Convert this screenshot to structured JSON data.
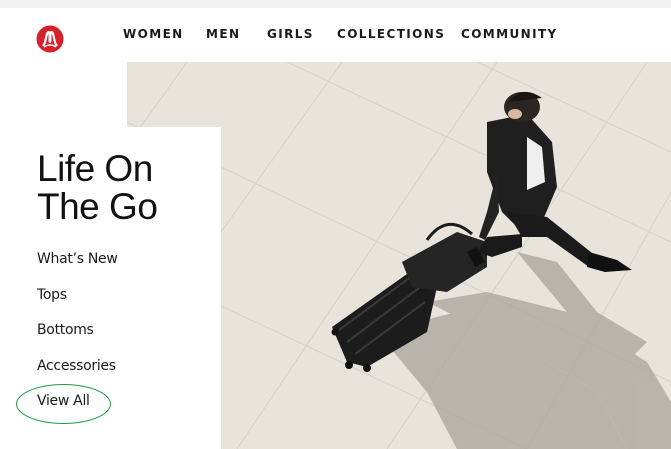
{
  "brand": {
    "logo_icon": "lululemon-logo-icon",
    "color": "#d6202a"
  },
  "nav": {
    "items": [
      "WOMEN",
      "MEN",
      "GIRLS",
      "COLLECTIONS",
      "COMMUNITY"
    ]
  },
  "hero": {
    "title_line1": "Life On",
    "title_line2": "The Go",
    "links": [
      "What’s New",
      "Tops",
      "Bottoms",
      "Accessories",
      "View All"
    ],
    "highlight_color": "#1e9b3c"
  }
}
